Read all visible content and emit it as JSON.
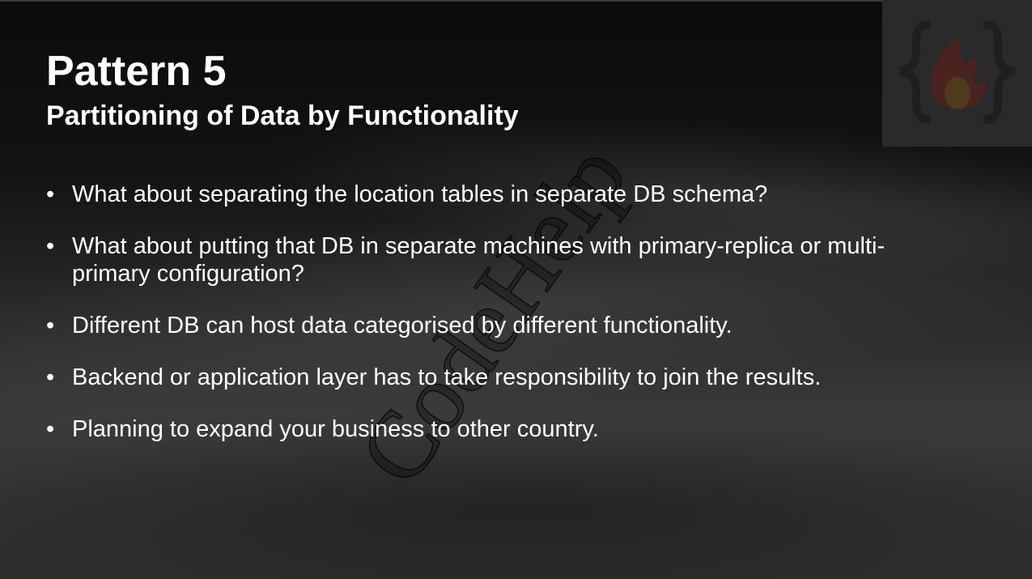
{
  "slide": {
    "title": "Pattern 5",
    "subtitle": "Partitioning of Data by Functionality",
    "bullet_glyph": "•",
    "bullets": [
      "What about separating the location tables in separate DB schema?",
      "What about putting that DB in separate machines with primary-replica or multi-primary configuration?",
      "Different DB can host data categorised by different functionality.",
      "Backend or application layer has to take responsibility to join the results.",
      "Planning to expand your business to other country."
    ],
    "watermark": "CodeHelp",
    "logo_icon": "braces-fire-icon"
  }
}
